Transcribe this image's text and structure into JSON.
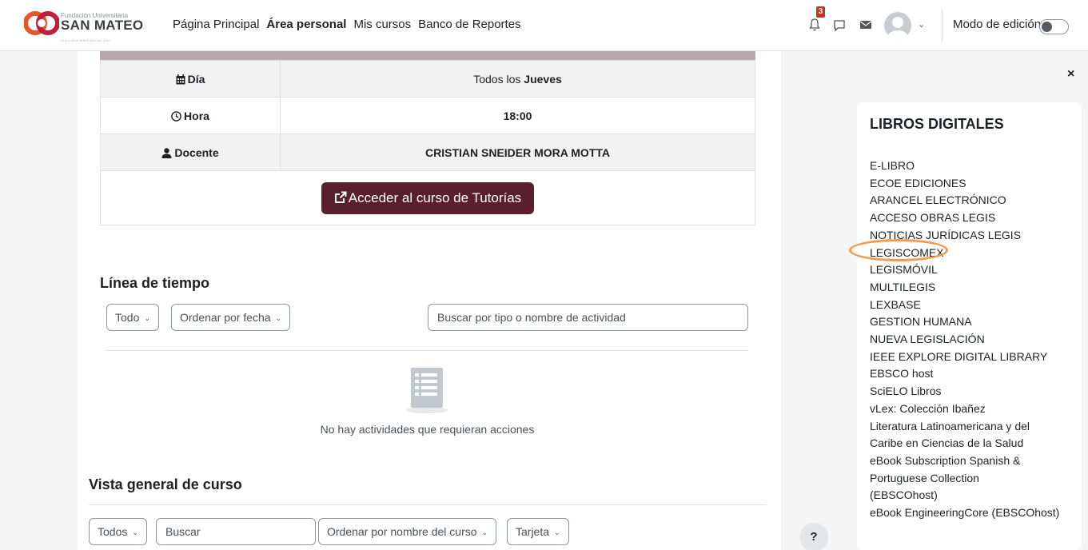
{
  "header": {
    "logo": {
      "small": "Fundación Universitaria",
      "big": "SAN MATEO",
      "tagline": "VIGILADA MINEDUCACIÓN"
    },
    "nav": [
      "Página Principal",
      "Área personal",
      "Mis cursos",
      "Banco de Reportes"
    ],
    "active_nav": "Área personal",
    "notification_count": "3",
    "edit_mode_label": "Modo de edición",
    "colors": {
      "badge": "#ca3120"
    }
  },
  "tutoria": {
    "rows": [
      {
        "label": "Día",
        "value_prefix": "Todos los ",
        "value_bold": "Jueves",
        "icon": "calendar-icon"
      },
      {
        "label": "Hora",
        "value": "18:00",
        "icon": "clock-icon"
      },
      {
        "label": "Docente",
        "value": "CRISTIAN SNEIDER MORA MOTTA",
        "icon": "user-icon"
      }
    ],
    "button_label": "Acceder al curso de Tutorías",
    "button_color": "#5a1f2e"
  },
  "timeline": {
    "title": "Línea de tiempo",
    "filter": "Todo",
    "sort": "Ordenar por fecha",
    "search_placeholder": "Buscar por tipo o nombre de actividad",
    "empty_message": "No hay actividades que requieran acciones"
  },
  "course_overview": {
    "title": "Vista general de curso",
    "filter": "Todos",
    "search_placeholder": "Buscar",
    "sort": "Ordenar por nombre del curso",
    "view": "Tarjeta"
  },
  "help_label": "?",
  "drawer": {
    "close_label": "×",
    "title": "LIBROS DIGITALES",
    "items": [
      "E-LIBRO",
      "ECOE EDICIONES",
      "ARANCEL ELECTRÓNICO",
      "ACCESO OBRAS LEGIS",
      "NOTICIAS JURÍDICAS LEGIS",
      "LEGISCOMEX",
      "LEGISMÓVIL",
      "MULTILEGIS",
      "LEXBASE",
      "GESTION HUMANA",
      "NUEVA LEGISLACIÓN",
      "IEEE EXPLORE DIGITAL LIBRARY",
      "EBSCO host",
      "SciELO Libros",
      "vLex: Colección Ibañez",
      "Literatura Latinoamericana y del Caribe en Ciencias de la Salud",
      "eBook Subscription Spanish & Portuguese Collection (EBSCOhost)",
      "eBook EngineeringCore (EBSCOhost)"
    ],
    "highlighted_item": "LEGISCOMEX",
    "highlight_color": "#f39a4c"
  }
}
